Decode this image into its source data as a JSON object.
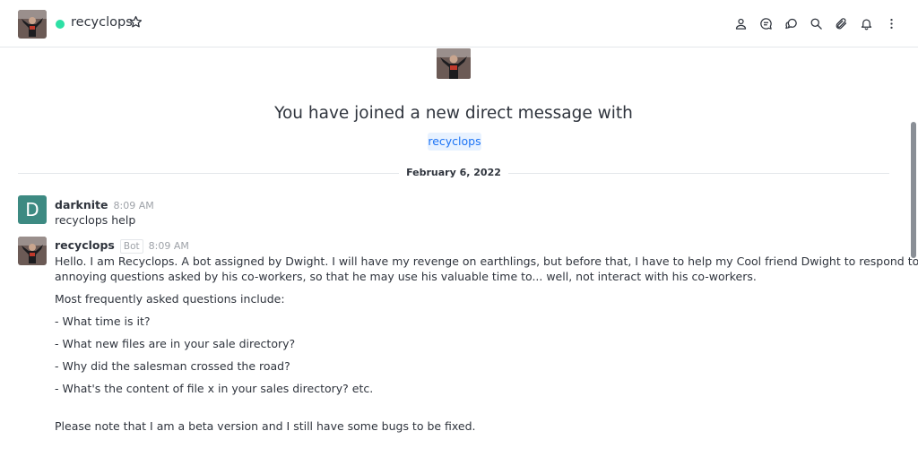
{
  "header": {
    "title": "recyclops",
    "status_color": "#2de0a5",
    "icons": [
      "user-info-icon",
      "discussion-icon",
      "threads-icon",
      "search-icon",
      "attachment-icon",
      "notification-bell-icon",
      "kebab-menu-icon"
    ]
  },
  "intro": {
    "title": "You have joined a new direct message with",
    "username": "recyclops"
  },
  "date_divider": "February 6, 2022",
  "messages": [
    {
      "username": "darknite",
      "avatar_letter": "D",
      "time": "8:09 AM",
      "lines": [
        "recyclops help"
      ]
    },
    {
      "username": "recyclops",
      "tag": "Bot",
      "time": "8:09 AM",
      "lines": [
        "Hello. I am Recyclops. A bot assigned by Dwight. I will have my revenge on earthlings, but before that, I have to help my Cool friend Dwight to respond to the",
        "annoying questions asked by his co-workers, so that he may use his valuable time to... well, not interact with his co-workers.",
        "Most frequently asked questions include:",
        "- What time is it?",
        "- What new files are in your sale directory?",
        "- Why did the salesman crossed the road?",
        "- What's the content of file x in your sales directory? etc.",
        "Please note that I am a beta version and I still have some bugs to be fixed."
      ]
    }
  ],
  "colors": {
    "accent": "#1d74f5",
    "mention_bg": "#e8f2ff",
    "avatar_d": "#3d8a82"
  }
}
